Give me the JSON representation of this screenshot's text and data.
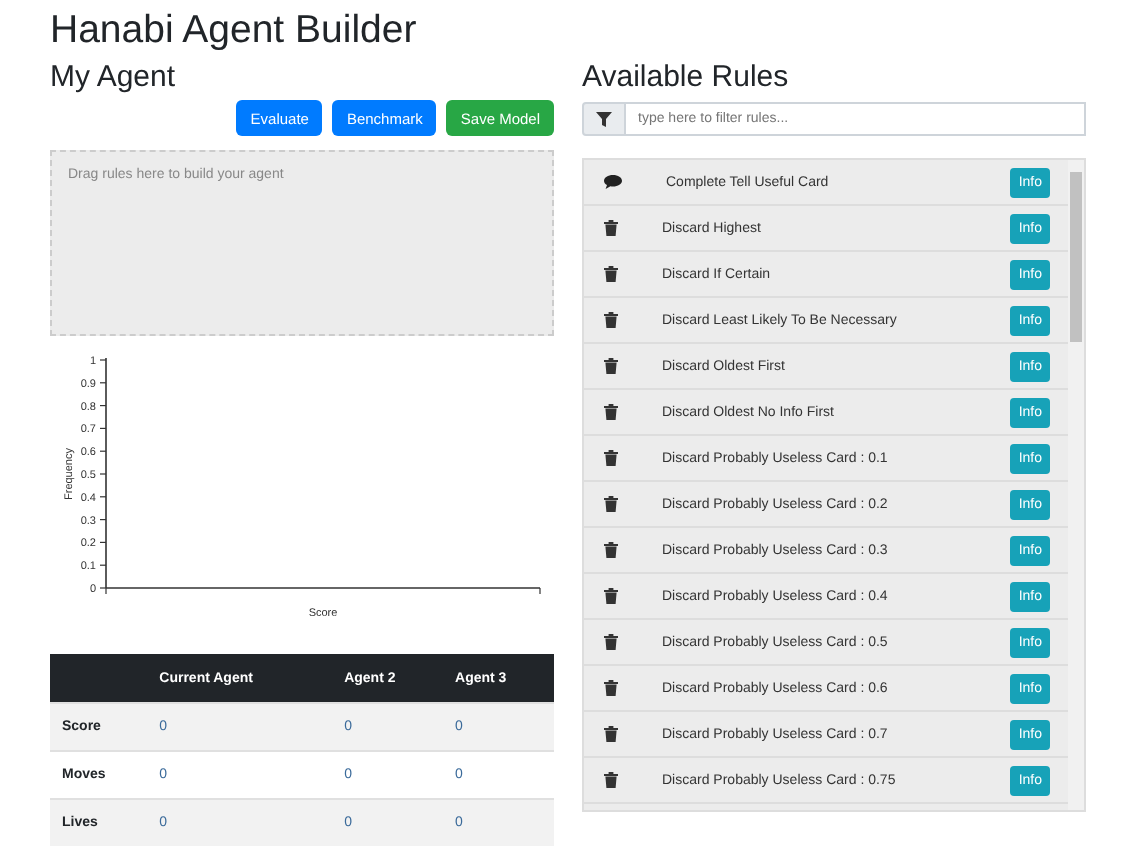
{
  "title": "Hanabi Agent Builder",
  "my_agent": {
    "heading": "My Agent",
    "buttons": [
      {
        "label": "Evaluate",
        "kind": "primary"
      },
      {
        "label": "Benchmark",
        "kind": "primary"
      },
      {
        "label": "Save Model",
        "kind": "success"
      }
    ],
    "dropzone": {
      "placeholder": "Drag rules here to build your agent"
    },
    "plot": {
      "xlabel": "Score",
      "ylabel": "Frequency",
      "yticks": [
        "1",
        "0.9",
        "0.8",
        "0.7",
        "0.6",
        "0.5",
        "0.4",
        "0.3",
        "0.2",
        "0.1",
        "0"
      ]
    },
    "table": {
      "columns": [
        "",
        "Current Agent",
        "Agent 2",
        "Agent 3"
      ],
      "rows": [
        [
          "Score",
          "0",
          "0",
          "0"
        ],
        [
          "Moves",
          "0",
          "0",
          "0"
        ],
        [
          "Lives",
          "0",
          "0",
          "0"
        ]
      ]
    }
  },
  "rules_panel": {
    "heading": "Available Rules",
    "filter": {
      "placeholder": "type here to filter rules..."
    },
    "rules": [
      {
        "name": "Complete Tell Useful Card",
        "kind": "hint",
        "button": "Info"
      },
      {
        "name": "Discard Highest",
        "kind": "discard",
        "button": "Info"
      },
      {
        "name": "Discard If Certain",
        "kind": "discard",
        "button": "Info"
      },
      {
        "name": "Discard Least Likely To Be Necessary",
        "kind": "discard",
        "button": "Info"
      },
      {
        "name": "Discard Oldest First",
        "kind": "discard",
        "button": "Info"
      },
      {
        "name": "Discard Oldest No Info First",
        "kind": "discard",
        "button": "Info"
      },
      {
        "name": "Discard Probably Useless Card : 0.1",
        "kind": "discard",
        "button": "Info"
      },
      {
        "name": "Discard Probably Useless Card : 0.2",
        "kind": "discard",
        "button": "Info"
      },
      {
        "name": "Discard Probably Useless Card : 0.3",
        "kind": "discard",
        "button": "Info"
      },
      {
        "name": "Discard Probably Useless Card : 0.4",
        "kind": "discard",
        "button": "Info"
      },
      {
        "name": "Discard Probably Useless Card : 0.5",
        "kind": "discard",
        "button": "Info"
      },
      {
        "name": "Discard Probably Useless Card : 0.6",
        "kind": "discard",
        "button": "Info"
      },
      {
        "name": "Discard Probably Useless Card : 0.7",
        "kind": "discard",
        "button": "Info"
      },
      {
        "name": "Discard Probably Useless Card : 0.75",
        "kind": "discard",
        "button": "Info"
      }
    ]
  }
}
